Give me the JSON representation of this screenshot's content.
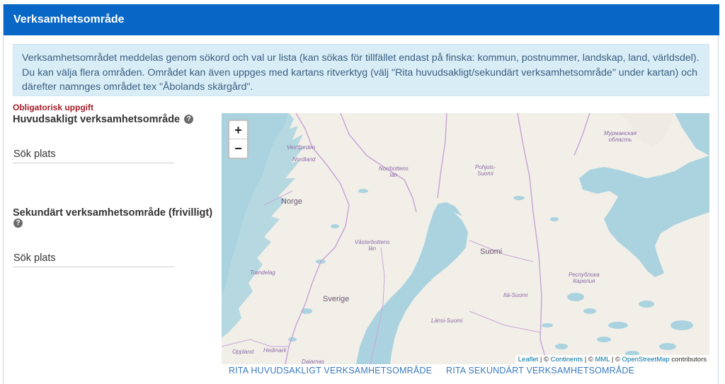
{
  "panel": {
    "title": "Verksamhetsområde"
  },
  "info": {
    "text": "Verksamhetsområdet meddelas genom sökord och val ur lista (kan sökas för tillfället endast på finska: kommun, postnummer, landskap, land, världsdel). Du kan välja flera områden. Området kan även uppges med kartans ritverktyg (välj \"Rita huvudsakligt/sekundärt verksamhetsområde\" under kartan) och därefter namnges området tex \"Åbolands skärgård\"."
  },
  "form": {
    "required_label": "Obligatorisk uppgift",
    "primary_label": "Huvudsakligt verksamhetsområde",
    "secondary_label": "Sekundärt verksamhetsområde (frivilligt)",
    "help_glyph": "?",
    "primary_placeholder": "Sök plats",
    "secondary_placeholder": "Sök plats"
  },
  "map": {
    "zoom_in": "+",
    "zoom_out": "−",
    "labels": {
      "vestfjorden": "Vestfjorden",
      "nordland": "Nordland",
      "norrbottens": "Norrbottens\nlän",
      "pohjois_suomi": "Pohjois-\nSuomi",
      "murmansk": "Мурманская\nобласть",
      "norge": "Norge",
      "vasterbottens": "Västerbottens\nlän",
      "suomi": "Suomi",
      "trondelag": "Trøndelag",
      "karelia": "Республика\nКарелия",
      "ita_suomi": "Itä-Suomi",
      "sverige": "Sverige",
      "lansi_suomi": "Länsi-Suomi",
      "oppland": "Oppland",
      "hedmark": "Hedmark",
      "dalarnas": "Dalarnas"
    },
    "attribution": {
      "leaflet": "Leaflet",
      "sep1": " | © ",
      "continents": "Continents",
      "sep2": " | © ",
      "mml": "MML",
      "sep3": " | © ",
      "osm": "OpenStreetMap",
      "contributors": " contributors"
    },
    "colors": {
      "land": "#f2efe9",
      "water": "#aad3df",
      "border": "#c9a6d6"
    }
  },
  "actions": {
    "draw_primary": "RITA HUVUDSAKLIGT VERKSAMHETSOMRÅDE",
    "draw_secondary": "RITA SEKUNDÄRT VERKSAMHETSOMRÅDE"
  }
}
